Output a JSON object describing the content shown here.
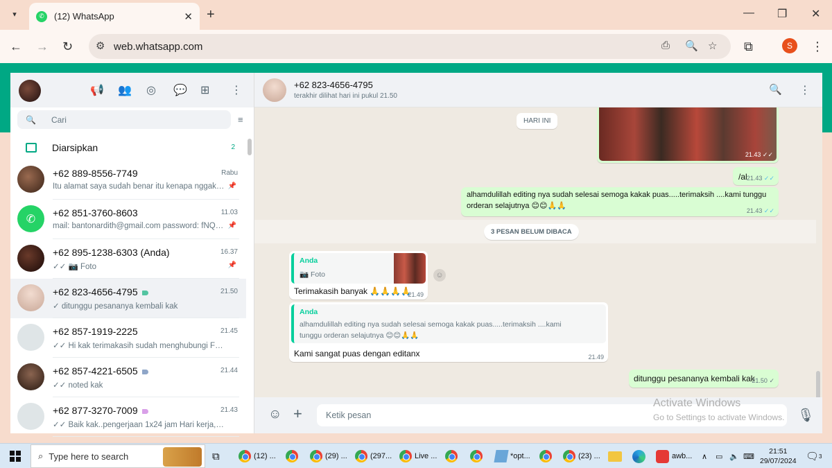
{
  "browser": {
    "tab_title": "(12) WhatsApp",
    "tab_list_icon": "chevron-down-icon",
    "url": "web.whatsapp.com",
    "profile_initial": "S"
  },
  "sidebar": {
    "search_placeholder": "Cari",
    "archived_label": "Diarsipkan",
    "archived_count": "2",
    "chats": [
      {
        "name": "+62 889-8556-7749",
        "time": "Rabu",
        "preview": "Itu alamat saya sudah benar itu kenapa nggak sa...",
        "pinned": true
      },
      {
        "name": "+62 851-3760-8603",
        "time": "11.03",
        "preview": "mail: bantonardith@gmail.com  password: fNQG...",
        "pinned": true
      },
      {
        "name": "+62 895-1238-6303 (Anda)",
        "time": "16.37",
        "preview": "✓✓ 📷 Foto",
        "pinned": true
      },
      {
        "name": "+62 823-4656-4795",
        "time": "21.50",
        "preview": "✓ ditunggu pesananya kembali kak",
        "label_color": "#53c4a1"
      },
      {
        "name": "+62 857-1919-2225",
        "time": "21.45",
        "preview": "✓✓ Hi kak terimakasih sudah menghubungi FOTOIN ..."
      },
      {
        "name": "+62 857-4221-6505",
        "time": "21.44",
        "preview": "✓✓ noted kak",
        "label_color": "#8fa6c8"
      },
      {
        "name": "+62 877-3270-7009",
        "time": "21.43",
        "preview": "✓✓ Baik kak..pengerjaan 1x24 jam Hari kerja,tidak te...",
        "label_color": "#d9a0e8"
      }
    ]
  },
  "conversation": {
    "contact_name": "+62 823-4656-4795",
    "contact_status": "terakhir dilihat hari ini pukul 21.50",
    "date_pill": "HARI INI",
    "image_time": "21.43",
    "msg_al": "/al",
    "msg_al_time": "21.43",
    "msg_thanks_line1": "alhamdulillah editing nya sudah selesai semoga kakak puas.....terimaksih ....kami tunggu",
    "msg_thanks_line2": "orderan selajutnya 😊😊🙏🙏",
    "msg_thanks_time": "21.43",
    "unread_pill": "3 PESAN BELUM DIBACA",
    "reply1": {
      "author": "Anda",
      "quoted": "📷 Foto",
      "text": "Terimakasih banyak 🙏🙏🙏🙏",
      "time": "21.49"
    },
    "reply2": {
      "author": "Anda",
      "quoted_line1": "alhamdulillah editing nya sudah selesai semoga kakak puas.....terimaksih ....kami",
      "quoted_line2": "tunggu orderan selajutnya 😊😊🙏🙏",
      "text": "Kami sangat puas dengan editanx",
      "time": "21.49"
    },
    "last_out": "ditunggu pesananya kembali kak",
    "last_out_time": "21.50",
    "compose_placeholder": "Ketik pesan"
  },
  "watermark": {
    "line1": "Activate Windows",
    "line2": "Go to Settings to activate Windows."
  },
  "taskbar": {
    "search_placeholder": "Type here to search",
    "items": [
      "(12) ...",
      "",
      "(29) ...",
      "(297...",
      "Live ...",
      "",
      "",
      "*opt...",
      "",
      "(23) ...",
      "",
      "",
      "awb..."
    ],
    "time": "21:51",
    "date": "29/07/2024",
    "notif_count": "3"
  }
}
